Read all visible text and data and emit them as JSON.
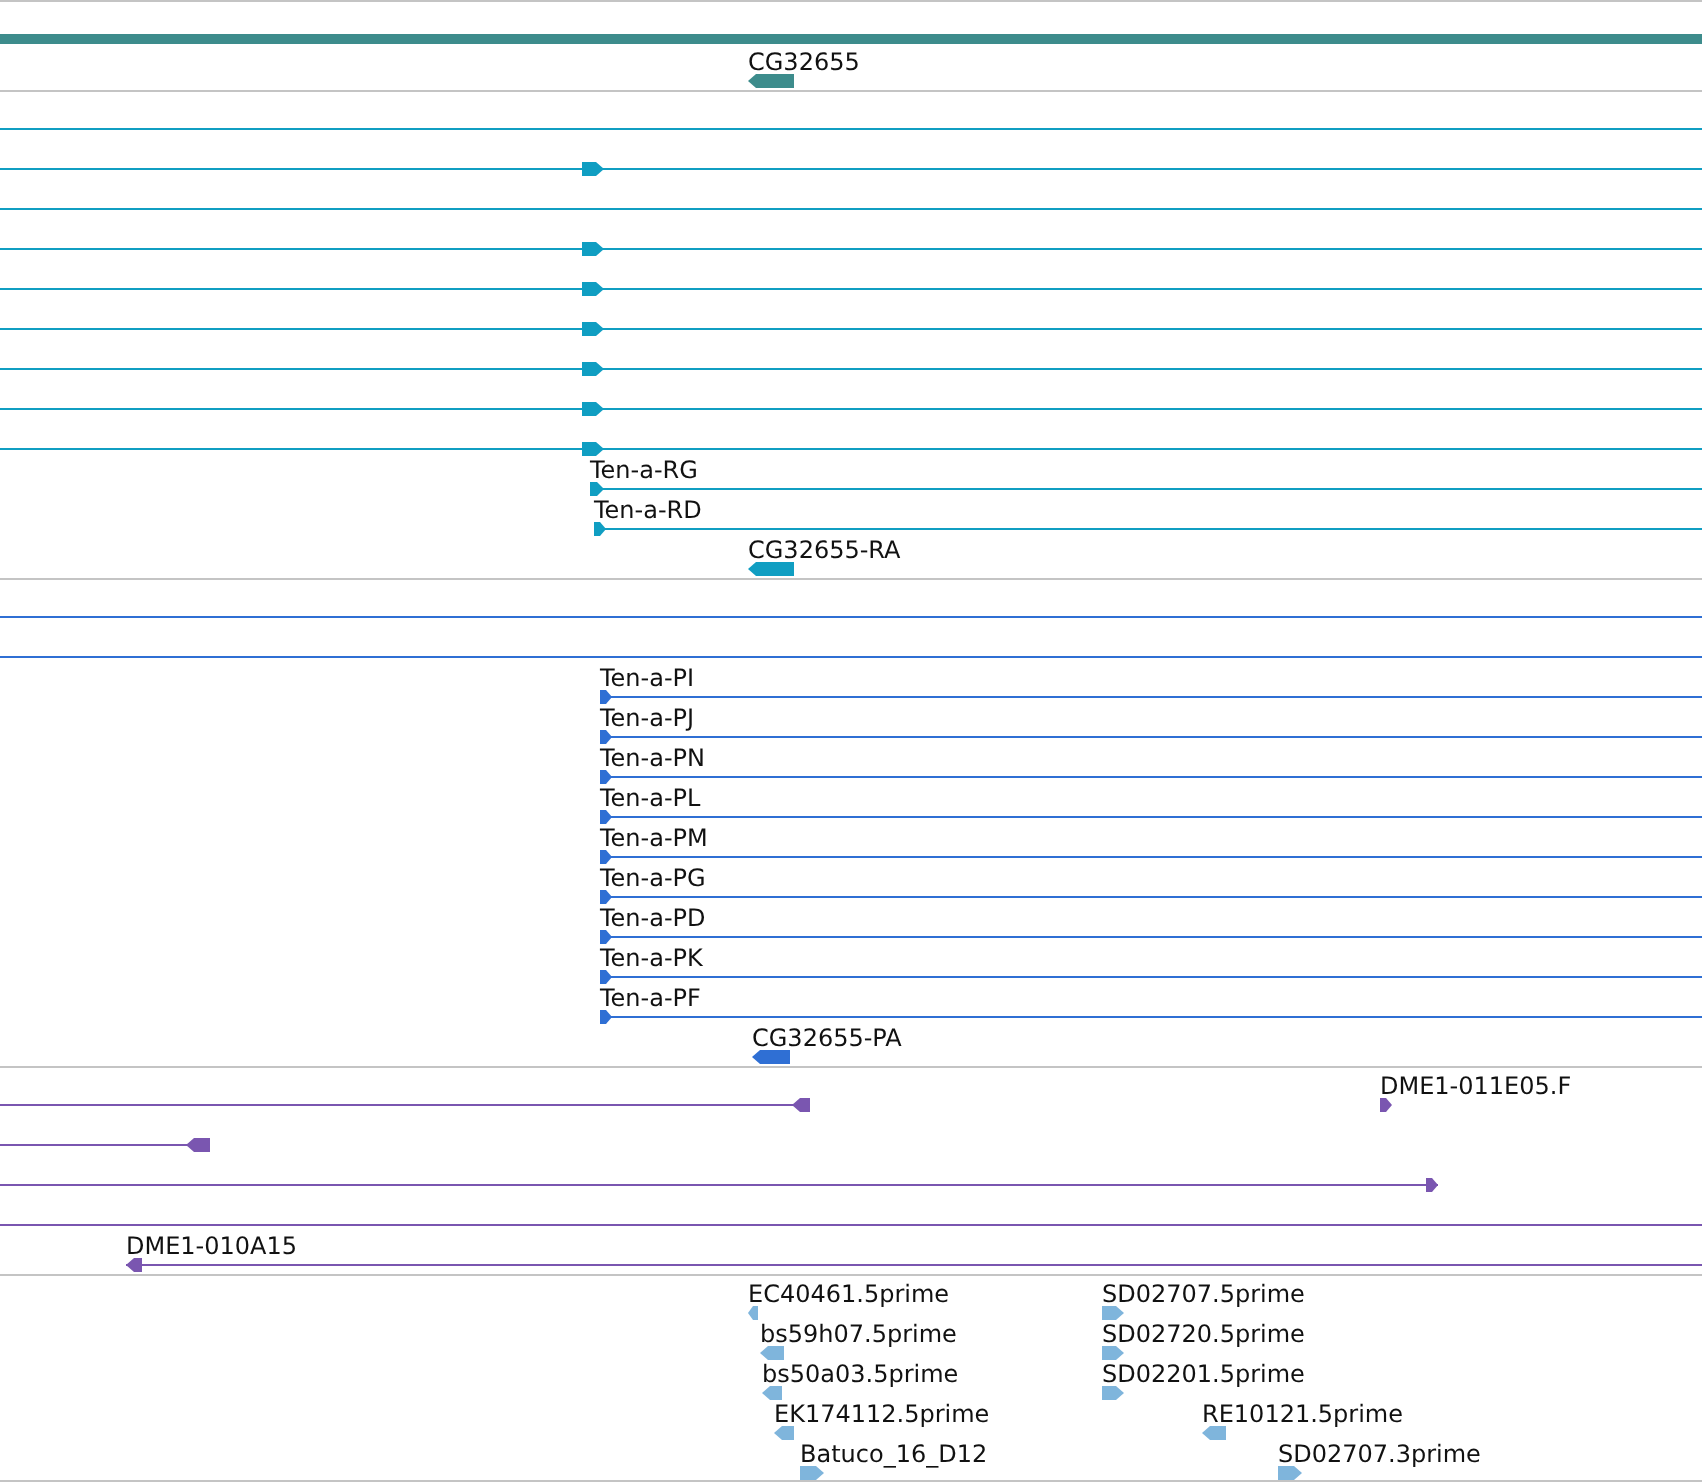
{
  "tracks": [
    {
      "color": "#3d8c8c",
      "features": [
        {
          "kind": "bar"
        },
        {
          "kind": "gene",
          "label": "CG32655",
          "reverse": true
        }
      ]
    },
    {
      "color": "#109ec2",
      "features": [
        {
          "kind": "line"
        },
        {
          "kind": "transcript",
          "reverse": false
        },
        {
          "kind": "line"
        },
        {
          "kind": "transcript",
          "reverse": false
        },
        {
          "kind": "transcript",
          "reverse": false
        },
        {
          "kind": "transcript",
          "reverse": false
        },
        {
          "kind": "transcript",
          "reverse": false
        },
        {
          "kind": "transcript",
          "reverse": false
        },
        {
          "kind": "transcript",
          "reverse": false
        },
        {
          "kind": "transcript",
          "label": "Ten-a-RG",
          "reverse": false
        },
        {
          "kind": "transcript",
          "label": "Ten-a-RD",
          "reverse": false
        },
        {
          "kind": "gene",
          "label": "CG32655-RA",
          "reverse": true
        }
      ]
    },
    {
      "color": "#2f6fd4",
      "features": [
        {
          "kind": "line"
        },
        {
          "kind": "line"
        },
        {
          "kind": "transcript",
          "label": "Ten-a-PI",
          "reverse": false
        },
        {
          "kind": "transcript",
          "label": "Ten-a-PJ",
          "reverse": false
        },
        {
          "kind": "transcript",
          "label": "Ten-a-PN",
          "reverse": false
        },
        {
          "kind": "transcript",
          "label": "Ten-a-PL",
          "reverse": false
        },
        {
          "kind": "transcript",
          "label": "Ten-a-PM",
          "reverse": false
        },
        {
          "kind": "transcript",
          "label": "Ten-a-PG",
          "reverse": false
        },
        {
          "kind": "transcript",
          "label": "Ten-a-PD",
          "reverse": false
        },
        {
          "kind": "transcript",
          "label": "Ten-a-PK",
          "reverse": false
        },
        {
          "kind": "transcript",
          "label": "Ten-a-PF",
          "reverse": false
        },
        {
          "kind": "gene",
          "label": "CG32655-PA",
          "reverse": true
        }
      ]
    },
    {
      "color": "#7a56b0",
      "features": [
        {
          "kind": "transcript",
          "reverse": true
        },
        {
          "kind": "gene",
          "label": "DME1-011E05.F",
          "reverse": false
        },
        {
          "kind": "transcript",
          "reverse": true
        },
        {
          "kind": "transcript",
          "reverse": false
        },
        {
          "kind": "line"
        },
        {
          "kind": "transcript",
          "label": "DME1-010A15",
          "reverse": true
        }
      ]
    },
    {
      "color": "#7fb5dc",
      "features": [
        {
          "kind": "gene",
          "label": "EC40461.5prime",
          "reverse": true
        },
        {
          "kind": "gene",
          "label": "bs59h07.5prime",
          "reverse": true
        },
        {
          "kind": "gene",
          "label": "bs50a03.5prime",
          "reverse": true
        },
        {
          "kind": "gene",
          "label": "EK174112.5prime",
          "reverse": true
        },
        {
          "kind": "gene",
          "label": "Batuco_16_D12",
          "reverse": false
        },
        {
          "kind": "gene",
          "label": "SD02707.5prime",
          "reverse": false
        },
        {
          "kind": "gene",
          "label": "SD02720.5prime",
          "reverse": false
        },
        {
          "kind": "gene",
          "label": "SD02201.5prime",
          "reverse": false
        },
        {
          "kind": "gene",
          "label": "RE10121.5prime",
          "reverse": true
        },
        {
          "kind": "gene",
          "label": "SD02707.3prime",
          "reverse": false
        }
      ]
    }
  ]
}
